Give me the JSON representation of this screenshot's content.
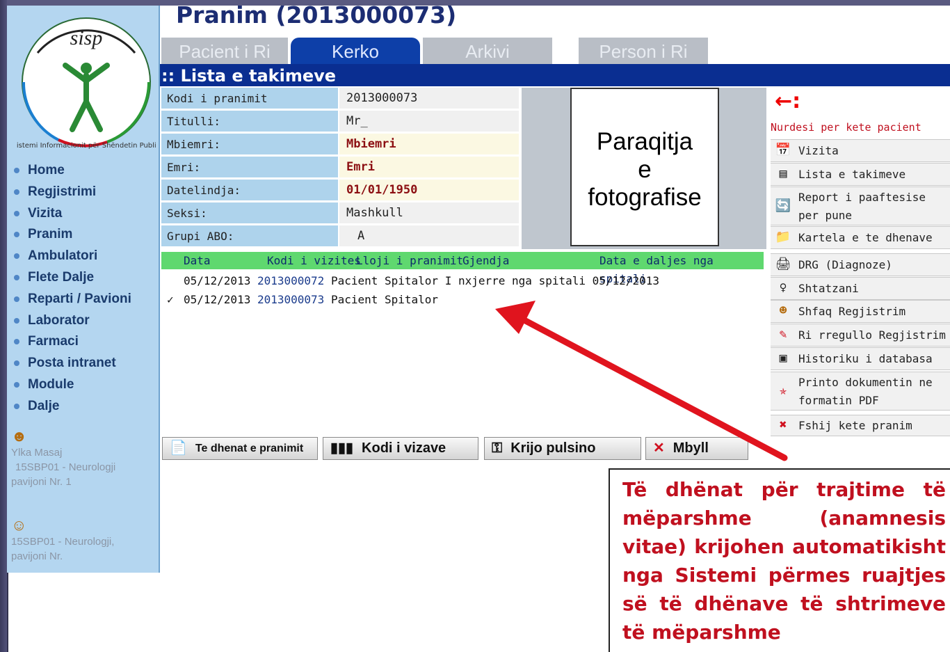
{
  "page_title": "Pranim (2013000073)",
  "tabs": [
    {
      "label": "Pacient i Ri",
      "active": false
    },
    {
      "label": "Kerko",
      "active": true
    },
    {
      "label": "Arkivi",
      "active": false
    },
    {
      "label": "Person i Ri",
      "active": false
    }
  ],
  "section_title": ":: Lista e takimeve",
  "logo": {
    "text": "sisp",
    "ring_text": "Sistemi Informacionit për Shëndetin Publik"
  },
  "nav": [
    "Home",
    "Regjistrimi",
    "Vizita",
    "Pranim",
    "Ambulatori",
    "Flete Dalje",
    "Reparti / Pavioni",
    "Laborator",
    "Farmaci",
    "Posta intranet",
    "Module",
    "Dalje"
  ],
  "user": {
    "name": "Ylka Masaj",
    "line2": "15SBP01 - Neurologji",
    "line3": "pavijoni Nr. 1",
    "dept_line1": "15SBP01 - Neurologji,",
    "dept_line2": "pavijoni Nr."
  },
  "patient": [
    {
      "label": "Kodi i pranimit",
      "value": "2013000073",
      "emphasis": false
    },
    {
      "label": "Titulli:",
      "value": "Mr_",
      "emphasis": false
    },
    {
      "label": "Mbiemri:",
      "value": "Mbiemri",
      "emphasis": true
    },
    {
      "label": "Emri:",
      "value": "Emri",
      "emphasis": true
    },
    {
      "label": "Datelindja:",
      "value": "01/01/1950",
      "emphasis": true
    },
    {
      "label": "Seksi:",
      "value": "Mashkull",
      "emphasis": false
    },
    {
      "label": "Grupi ABO:",
      "value": "A",
      "emphasis": false
    }
  ],
  "photo_placeholder": {
    "line1": "Paraqitja",
    "line2": "e",
    "line3": "fotografise"
  },
  "admissions": {
    "headers": [
      "Data",
      "Kodi i vizites",
      "Lloji i pranimit",
      "Gjendja",
      "Data e daljes nga spitali"
    ],
    "rows": [
      {
        "check": "",
        "date": "05/12/2013",
        "code": "2013000072",
        "type": "Pacient Spitalor",
        "status": "I nxjerre nga spitali",
        "discharge": "05/12/2013"
      },
      {
        "check": "✓",
        "date": "05/12/2013",
        "code": "2013000073",
        "type": "Pacient Spitalor",
        "status": "",
        "discharge": ""
      }
    ]
  },
  "buttons": [
    {
      "label": "Te dhenat e pranimit",
      "icon": "document-icon"
    },
    {
      "label": "Kodi i vizave",
      "icon": "barcode-icon"
    },
    {
      "label": "Krijo pulsino",
      "icon": "bracelet-icon"
    },
    {
      "label": "Mbyll",
      "icon": "close-icon"
    }
  ],
  "actions_header": "Nurdesi per kete pacient",
  "actions": [
    {
      "label": "Vizita",
      "icon": "calendar-icon"
    },
    {
      "label": "Lista e takimeve",
      "icon": "list-icon"
    },
    {
      "label": "Report i paaftesise\nper pune",
      "icon": "report-icon"
    },
    {
      "label": "Kartela e te dhenave",
      "icon": "folder-icon"
    },
    {
      "label": "DRG (Diagnoze)",
      "icon": "printer-icon"
    },
    {
      "label": "Shtatzani",
      "icon": "pregnancy-icon"
    },
    {
      "label": "Shfaq Regjistrim",
      "icon": "user-view-icon"
    },
    {
      "label": "Ri rregullo Regjistrim",
      "icon": "user-edit-icon"
    },
    {
      "label": "Historiku i databasa",
      "icon": "history-icon"
    },
    {
      "label": "Printo dokumentin ne\nformatin PDF",
      "icon": "pdf-icon"
    },
    {
      "label": "Fshij kete pranim",
      "icon": "delete-icon"
    }
  ],
  "annotation": "Të dhënat për trajtime të mëparshme (anamnesis vitae) krijohen automatikisht nga Sistemi përmes ruajtjes së të dhënave të shtrimeve të mëparshme",
  "colors": {
    "sidebar": "#b4d6f0",
    "header_bar": "#0a2e91",
    "label_bg": "#aed3ec",
    "table_head": "#5fd86f",
    "accent_red": "#c0101f"
  }
}
